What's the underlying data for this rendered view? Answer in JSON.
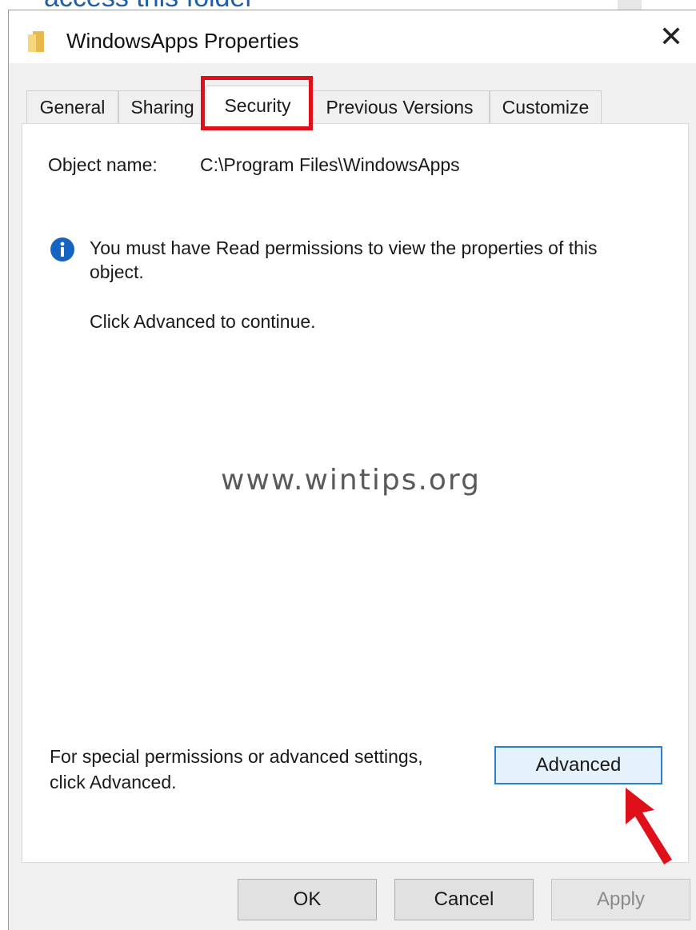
{
  "background": {
    "partial_text": "access this folder"
  },
  "window": {
    "title": "WindowsApps Properties",
    "close_glyph": "✕",
    "icon": "folder-icon"
  },
  "tabs": [
    {
      "label": "General",
      "active": false
    },
    {
      "label": "Sharing",
      "active": false
    },
    {
      "label": "Security",
      "active": true
    },
    {
      "label": "Previous Versions",
      "active": false
    },
    {
      "label": "Customize",
      "active": false
    }
  ],
  "security": {
    "object_name_label": "Object name:",
    "object_name_value": "C:\\Program Files\\WindowsApps",
    "info_icon": "info-icon",
    "message_line1": "You must have Read permissions to view the properties of this",
    "message_line2": "object.",
    "continue_text": "Click Advanced to continue.",
    "special_line1": "For special permissions or advanced settings,",
    "special_line2": "click Advanced.",
    "advanced_label": "Advanced"
  },
  "watermark": "www.wintips.org",
  "buttons": {
    "ok": "OK",
    "cancel": "Cancel",
    "apply": "Apply"
  },
  "colors": {
    "highlight_red": "#e0101a",
    "info_blue": "#1565c0",
    "focus_blue": "#2a7fd4"
  }
}
